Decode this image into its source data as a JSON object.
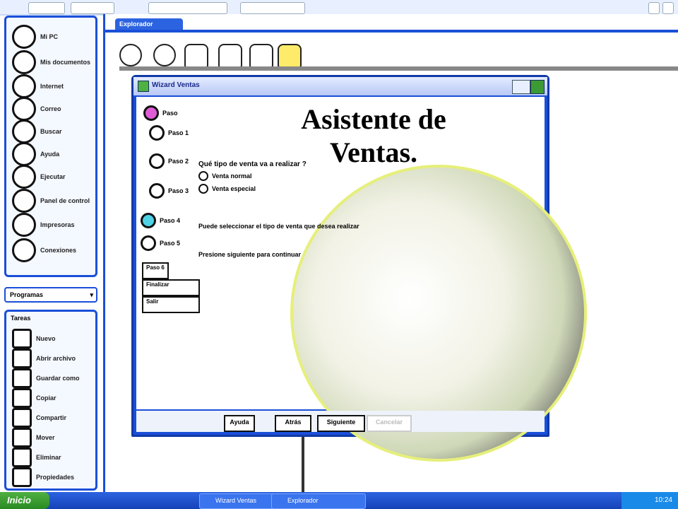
{
  "dialog": {
    "title": "Wizard Ventas",
    "heading": "Asistente de Ventas.",
    "steps": [
      {
        "label": "Paso"
      },
      {
        "label": "Paso 1"
      },
      {
        "label": "Paso 2"
      },
      {
        "label": "Paso 3"
      },
      {
        "label": "Paso 4"
      },
      {
        "label": "Paso 5"
      }
    ],
    "left_buttons": [
      "Paso 6",
      "Finalizar",
      "Salir"
    ],
    "question": "Qué tipo de venta va a realizar ?",
    "options": [
      "Venta normal",
      "Venta especial"
    ],
    "info_lines": [
      "Puede seleccionar el tipo de venta que desea realizar",
      "Presione siguiente para continuar"
    ],
    "footer_buttons": [
      "Ayuda",
      "Atrás",
      "Siguiente",
      "Cancelar"
    ]
  },
  "sidebar": {
    "items": [
      "Mi PC",
      "Mis documentos",
      "Internet",
      "Correo",
      "Buscar",
      "Ayuda",
      "Ejecutar",
      "Panel de control",
      "Impresoras",
      "Conexiones"
    ],
    "dropdown_value": "Programas",
    "tasks_title": "Tareas",
    "tasks": [
      "Nuevo",
      "Abrir archivo",
      "Guardar como",
      "Copiar",
      "Compartir",
      "Mover",
      "Eliminar",
      "Propiedades"
    ]
  },
  "explorer": {
    "tab": "Explorador"
  },
  "taskbar": {
    "start": "Inicio",
    "items": [
      "Wizard Ventas",
      "Explorador"
    ],
    "clock": "10:24"
  },
  "colors": {
    "accent": "#1a4fd8",
    "orange": "#ff6a1a",
    "green": "#4fb043"
  }
}
